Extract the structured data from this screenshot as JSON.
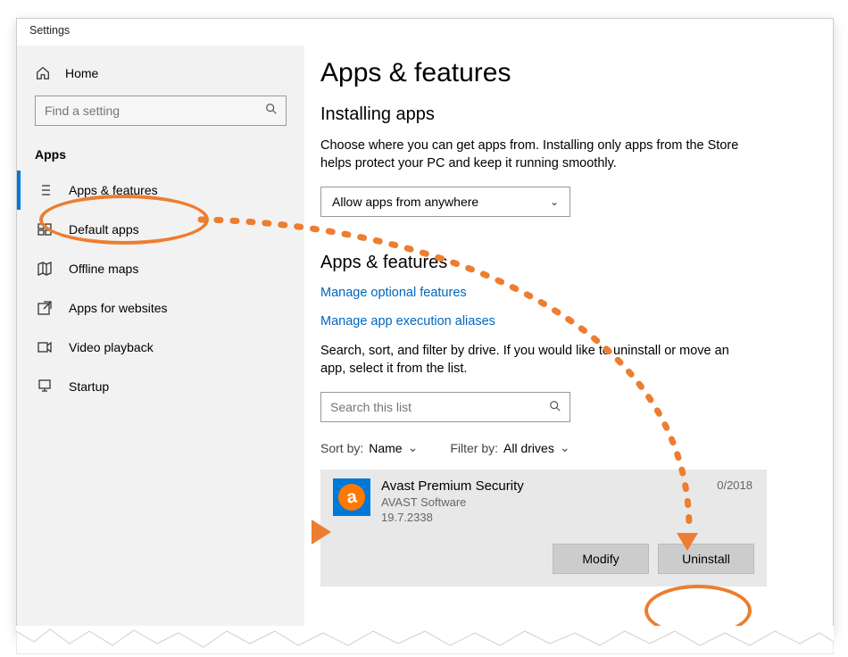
{
  "window": {
    "title": "Settings"
  },
  "sidebar": {
    "home": "Home",
    "search_placeholder": "Find a setting",
    "section": "Apps",
    "items": [
      {
        "label": "Apps & features",
        "selected": true
      },
      {
        "label": "Default apps",
        "selected": false
      },
      {
        "label": "Offline maps",
        "selected": false
      },
      {
        "label": "Apps for websites",
        "selected": false
      },
      {
        "label": "Video playback",
        "selected": false
      },
      {
        "label": "Startup",
        "selected": false
      }
    ]
  },
  "page": {
    "title": "Apps & features",
    "installing": {
      "heading": "Installing apps",
      "description": "Choose where you can get apps from. Installing only apps from the Store helps protect your PC and keep it running smoothly.",
      "source_selected": "Allow apps from anywhere"
    },
    "appsfeat": {
      "heading": "Apps & features",
      "link_optional": "Manage optional features",
      "link_aliases": "Manage app execution aliases",
      "description": "Search, sort, and filter by drive. If you would like to uninstall or move an app, select it from the list.",
      "search_placeholder": "Search this list",
      "sort_label": "Sort by:",
      "sort_value": "Name",
      "filter_label": "Filter by:",
      "filter_value": "All drives"
    },
    "app": {
      "name": "Avast Premium Security",
      "publisher": "AVAST Software",
      "version": "19.7.2338",
      "date_fragment": "0/2018",
      "modify": "Modify",
      "uninstall": "Uninstall"
    }
  }
}
